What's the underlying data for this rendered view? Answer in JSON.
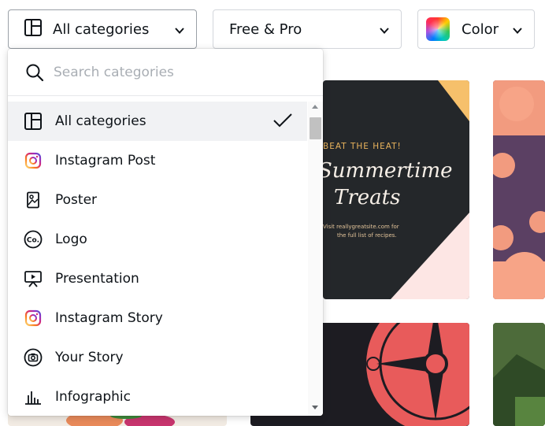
{
  "filters": {
    "category": {
      "label": "All categories",
      "icon": "template-layout-icon"
    },
    "price": {
      "label": "Free & Pro"
    },
    "color": {
      "label": "Color",
      "icon": "rainbow-swatch-icon"
    }
  },
  "dropdown": {
    "search_placeholder": "Search categories",
    "selected_index": 0,
    "items": [
      {
        "label": "All categories",
        "icon": "template-layout-icon",
        "selected": true
      },
      {
        "label": "Instagram Post",
        "icon": "instagram-icon"
      },
      {
        "label": "Poster",
        "icon": "poster-icon"
      },
      {
        "label": "Logo",
        "icon": "logo-icon"
      },
      {
        "label": "Presentation",
        "icon": "presentation-icon"
      },
      {
        "label": "Instagram Story",
        "icon": "instagram-icon"
      },
      {
        "label": "Your Story",
        "icon": "your-story-icon"
      },
      {
        "label": "Infographic",
        "icon": "infographic-icon"
      }
    ]
  },
  "templates": {
    "summertime": {
      "kicker": "BEAT THE HEAT!",
      "title_line1": "Summertime",
      "title_line2": "Treats",
      "small_line1": "Visit reallygreatsite.com for",
      "small_line2": "the full list of recipes."
    }
  },
  "colors": {
    "text": "#0e1318",
    "placeholder": "#a9aeb4",
    "selected_row": "#f1f2f4",
    "border": "#d3d6db",
    "instagram_gradient": [
      "#feda75",
      "#fa7e1e",
      "#d62976",
      "#962fbf",
      "#4f5bd5"
    ]
  }
}
